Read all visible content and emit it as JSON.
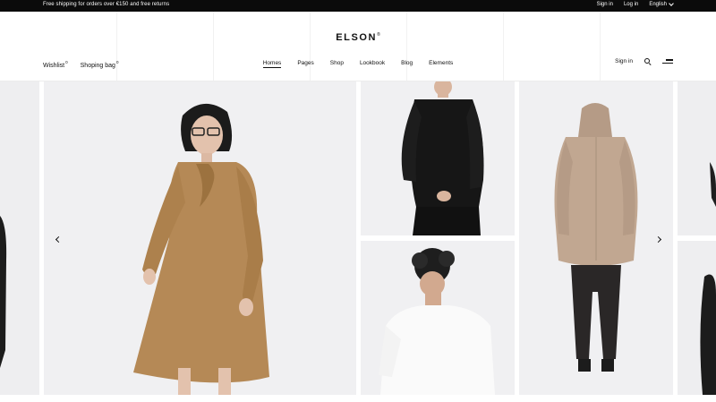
{
  "topbar": {
    "promo": "Free shipping for orders over €150 and free returns",
    "sign_in": "Sign in",
    "log_in": "Log in",
    "language": "English"
  },
  "header": {
    "logo": "ELSON",
    "logo_mark": "®",
    "wishlist_label": "Wishlist",
    "wishlist_count": "0",
    "bag_label": "Shoping bag",
    "bag_count": "0",
    "nav": [
      "Homes",
      "Pages",
      "Shop",
      "Lookbook",
      "Blog",
      "Elements"
    ],
    "sign_in": "Sign in"
  },
  "icons": {
    "search": "search-icon",
    "menu": "hamburger-menu-icon",
    "prev": "arrow-left-icon",
    "next": "arrow-right-icon",
    "language_caret": "chevron-down-icon"
  },
  "colors": {
    "topbar_bg": "#0b0b0b",
    "panel_bg": "#f1f1f3",
    "text": "#111111"
  }
}
